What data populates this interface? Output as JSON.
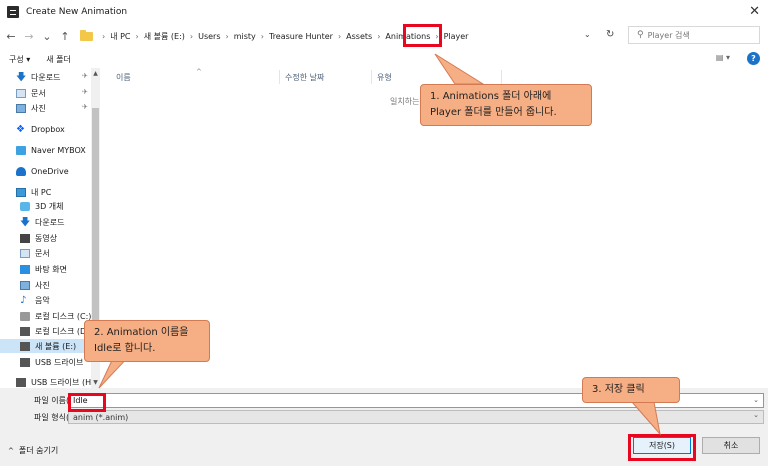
{
  "window": {
    "title": "Create New Animation",
    "close": "✕"
  },
  "nav": {
    "back": "←",
    "forward": "→",
    "recent": "⌄",
    "up": "↑"
  },
  "address": {
    "crumbs": [
      "내 PC",
      "새 볼륨 (E:)",
      "Users",
      "misty",
      "Treasure Hunter",
      "Assets",
      "Animations",
      "Player"
    ],
    "separator": "›",
    "dropdown": "⌄",
    "refresh": "↻"
  },
  "search": {
    "placeholder": "Player 검색",
    "icon": "⚲"
  },
  "toolbar": {
    "organize": "구성 ▾",
    "new_folder": "새 폴더",
    "view": "▤ ▾",
    "help": "?"
  },
  "sidebar": {
    "items": [
      {
        "label": "다운로드",
        "icon": "download-icon",
        "pin": "✈"
      },
      {
        "label": "문서",
        "icon": "document-icon",
        "pin": "✈"
      },
      {
        "label": "사진",
        "icon": "picture-icon",
        "pin": "✈"
      },
      {
        "label": "Dropbox",
        "icon": "dropbox-icon"
      },
      {
        "label": "Naver MYBOX",
        "icon": "naver-mybox-icon"
      },
      {
        "label": "OneDrive",
        "icon": "onedrive-icon"
      },
      {
        "label": "내 PC",
        "icon": "pc-icon"
      },
      {
        "label": "3D 개체",
        "icon": "3d-objects-icon"
      },
      {
        "label": "다운로드",
        "icon": "download-icon"
      },
      {
        "label": "동영상",
        "icon": "video-icon"
      },
      {
        "label": "문서",
        "icon": "document-icon"
      },
      {
        "label": "바탕 화면",
        "icon": "desktop-icon"
      },
      {
        "label": "사진",
        "icon": "picture-icon"
      },
      {
        "label": "음악",
        "icon": "music-icon"
      },
      {
        "label": "로컬 디스크 (C:)",
        "icon": "local-disk-icon"
      },
      {
        "label": "로컬 디스크 (D:)",
        "icon": "local-disk-icon"
      },
      {
        "label": "새 볼륨 (E:)",
        "icon": "volume-icon",
        "selected": true
      },
      {
        "label": "USB 드라이브",
        "icon": "usb-drive-icon"
      },
      {
        "label": "USB 드라이브 (H:)",
        "icon": "usb-drive-icon"
      }
    ]
  },
  "columns": {
    "name": "이름",
    "modified": "수정한 날짜",
    "type": "유형"
  },
  "file_list": {
    "empty_message": "일치하는"
  },
  "form": {
    "filename_label": "파일 이름(N):",
    "filename_value": "Idle",
    "filetype_label": "파일 형식(T):",
    "filetype_value": "anim (*.anim)"
  },
  "footer": {
    "hide_folders": "폴더 숨기기",
    "save": "저장(S)",
    "cancel": "취소"
  },
  "annotations": {
    "callout1_line1": "1. Animations 폴더 아래에",
    "callout1_line2": "Player 폴더를 만들어 줍니다.",
    "callout2_line1": "2. Animation 이름을",
    "callout2_line2": "Idle로 합니다.",
    "callout3": "3. 저장 클릭"
  },
  "colors": {
    "highlight": "#e8071f",
    "callout_fill": "#f6ae84",
    "accent": "#0078d7"
  }
}
